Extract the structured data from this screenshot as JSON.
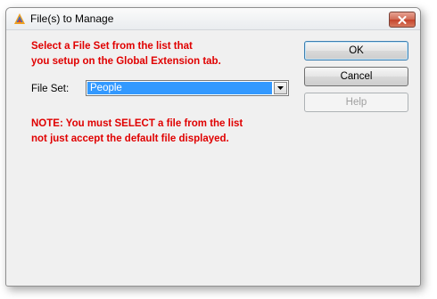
{
  "window": {
    "title": "File(s) to Manage"
  },
  "instructions": {
    "line1": "Select a File Set from the list that",
    "line2": "you setup on the Global Extension tab."
  },
  "file_set": {
    "label": "File Set:",
    "value": "People"
  },
  "note": {
    "line1": "NOTE: You must SELECT a file from the list",
    "line2": "not just accept the default file displayed."
  },
  "buttons": {
    "ok": "OK",
    "cancel": "Cancel",
    "help": "Help"
  },
  "colors": {
    "message_red": "#e00000",
    "selection_blue": "#3399ff",
    "close_red": "#c4432b"
  },
  "icons": {
    "app": "triangle-app-icon",
    "close": "close-icon",
    "dropdown": "chevron-down-icon"
  }
}
